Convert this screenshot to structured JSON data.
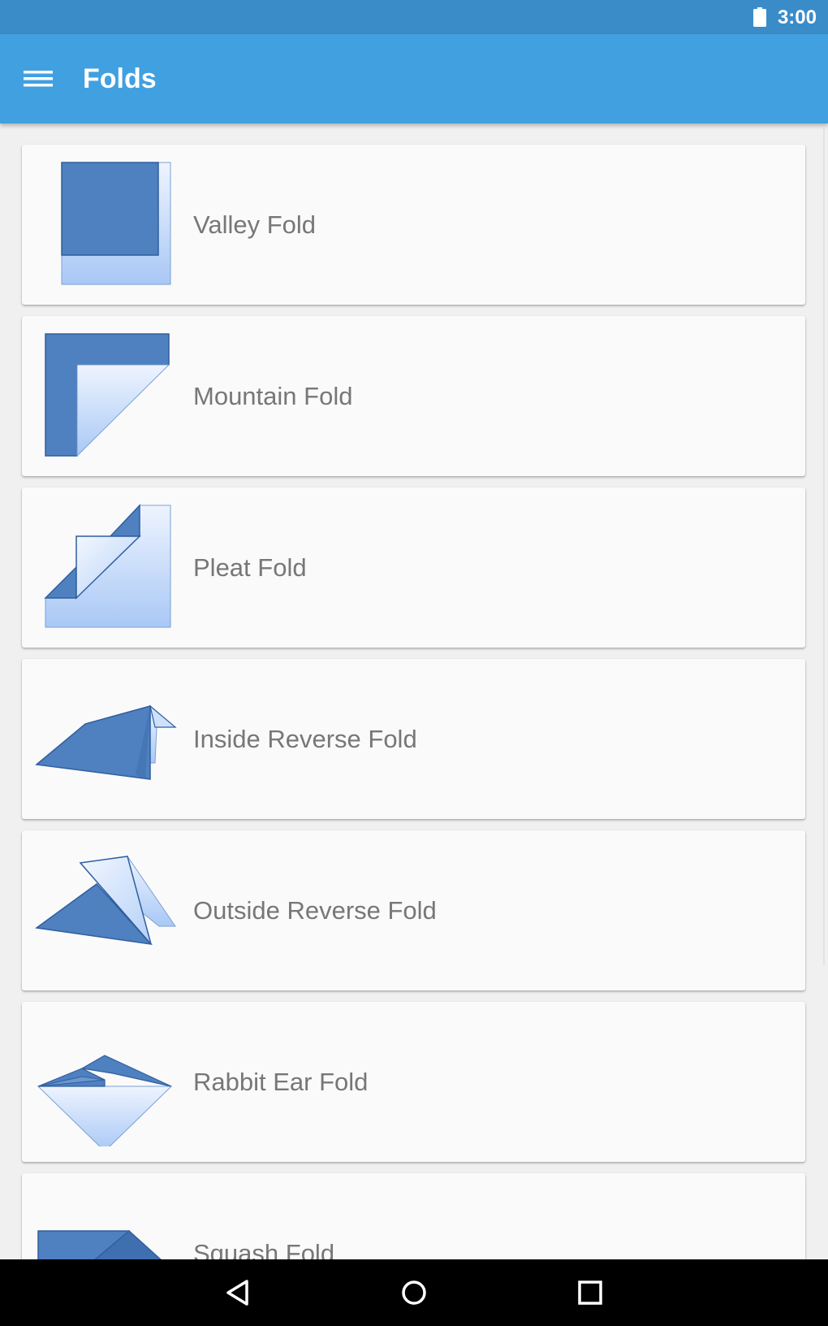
{
  "status_bar": {
    "time": "3:00",
    "battery_icon": "battery-full-icon"
  },
  "app_bar": {
    "menu_icon": "hamburger-menu-icon",
    "title": "Folds"
  },
  "folds": [
    {
      "label": "Valley Fold",
      "icon": "valley-fold-icon"
    },
    {
      "label": "Mountain Fold",
      "icon": "mountain-fold-icon"
    },
    {
      "label": "Pleat Fold",
      "icon": "pleat-fold-icon"
    },
    {
      "label": "Inside Reverse Fold",
      "icon": "inside-reverse-fold-icon"
    },
    {
      "label": "Outside Reverse Fold",
      "icon": "outside-reverse-fold-icon"
    },
    {
      "label": "Rabbit Ear Fold",
      "icon": "rabbit-ear-fold-icon"
    },
    {
      "label": "Squash Fold",
      "icon": "squash-fold-icon"
    }
  ],
  "nav_bar": {
    "back_icon": "back-icon",
    "home_icon": "home-icon",
    "recents_icon": "recents-icon"
  },
  "colors": {
    "status_bar": "#3a8cc9",
    "app_bar": "#41a0e0",
    "fold_dark": "#4f80bf",
    "fold_light": "#cfe0fb"
  }
}
